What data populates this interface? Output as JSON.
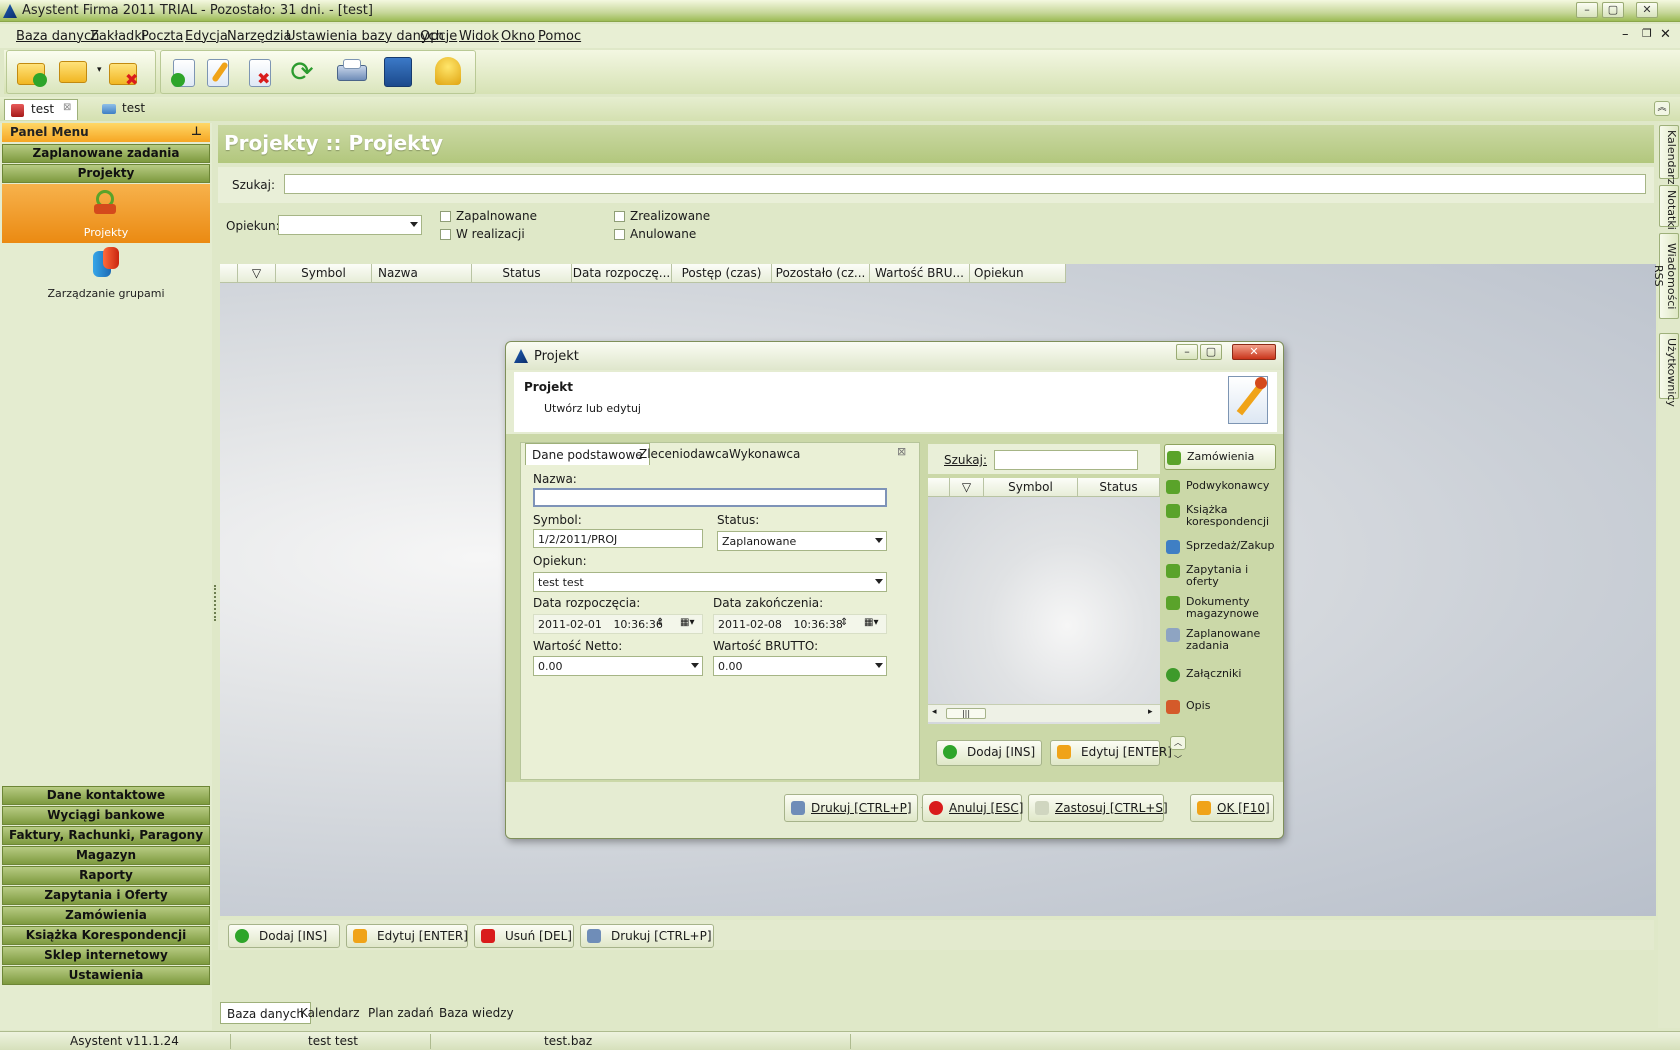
{
  "window": {
    "title": "Asystent Firma 2011 TRIAL - Pozostało: 31 dni. - [test]"
  },
  "menu": [
    "Baza danych",
    "Zakładki",
    "Poczta",
    "Edycja",
    "Narzędzia",
    "Ustawienia bazy danych",
    "Opcje",
    "Widok",
    "Okno",
    "Pomoc"
  ],
  "doc_tabs": [
    "test",
    "test"
  ],
  "panel": {
    "title": "Panel Menu",
    "top_groups": [
      "Zaplanowane zadania",
      "Projekty"
    ],
    "items": [
      "Projekty",
      "Zarządzanie grupami"
    ],
    "bottom_groups": [
      "Dane kontaktowe",
      "Wyciągi bankowe",
      "Faktury, Rachunki, Paragony",
      "Magazyn",
      "Raporty",
      "Zapytania i Oferty",
      "Zamówienia",
      "Książka Korespondencji",
      "Sklep internetowy",
      "Ustawienia"
    ]
  },
  "page": {
    "title": "Projekty :: Projekty",
    "search_label": "Szukaj:",
    "opiekun_label": "Opiekun:",
    "filters": [
      "Zapalnowane",
      "W realizacji",
      "Zrealizowane",
      "Anulowane"
    ],
    "columns": [
      "Symbol",
      "Nazwa",
      "Status",
      "Data rozpoczę...",
      "Postęp (czas)",
      "Pozostało (cz...",
      "Wartość BRU...",
      "Opiekun"
    ]
  },
  "bottom_buttons": [
    "Dodaj [INS]",
    "Edytuj [ENTER]",
    "Usuń [DEL]",
    "Drukuj [CTRL+P]"
  ],
  "bottom_tabs": [
    "Baza danych",
    "Kalendarz",
    "Plan zadań",
    "Baza wiedzy"
  ],
  "side_tabs": [
    "Kalendarz",
    "Notatki",
    "Wiadomości RSS",
    "Użytkownicy"
  ],
  "status": [
    "Asystent v11.1.24",
    "test test",
    "test.baz"
  ],
  "dialog": {
    "title": "Projekt",
    "header_title": "Projekt",
    "header_sub": "Utwórz lub edytuj",
    "tabs": [
      "Dane podstawowe",
      "Zleceniodawca",
      "Wykonawca"
    ],
    "fields": {
      "nazwa_label": "Nazwa:",
      "nazwa_value": "",
      "symbol_label": "Symbol:",
      "symbol_value": "1/2/2011/PROJ",
      "status_label": "Status:",
      "status_value": "Zaplanowane",
      "opiekun_label": "Opiekun:",
      "opiekun_value": "test test",
      "start_label": "Data rozpoczęcia:",
      "start_date": "2011-02-01",
      "start_time": "10:36:36",
      "end_label": "Data zakończenia:",
      "end_date": "2011-02-08",
      "end_time": "10:36:38",
      "netto_label": "Wartość Netto:",
      "netto_value": "0.00",
      "brutto_label": "Wartość BRUTTO:",
      "brutto_value": "0.00"
    },
    "right": {
      "search_label": "Szukaj:",
      "columns": [
        "Symbol",
        "Status"
      ],
      "buttons": [
        "Dodaj [INS]",
        "Edytuj [ENTER]"
      ],
      "nav": [
        "Zamówienia",
        "Podwykonawcy",
        "Książka korespondencji",
        "Sprzedaż/Zakup",
        "Zapytania i oferty",
        "Dokumenty magazynowe",
        "Zaplanowane zadania",
        "Załączniki",
        "Opis"
      ]
    },
    "footer_buttons": [
      "Drukuj [CTRL+P]",
      "Anuluj [ESC]",
      "Zastosuj [CTRL+S]",
      "OK [F10]"
    ]
  }
}
